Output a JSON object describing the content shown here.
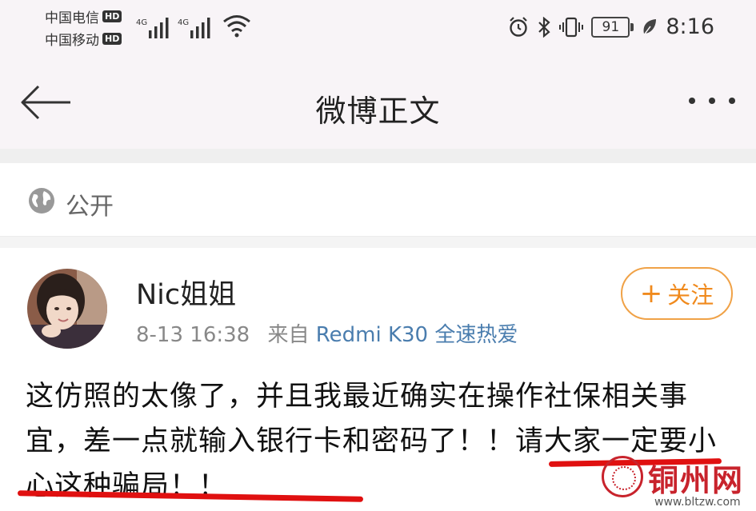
{
  "status_bar": {
    "carrier_1": "中国电信",
    "carrier_2": "中国移动",
    "hd_badge": "HD",
    "network_1": "4G",
    "network_2": "4G",
    "battery": "91",
    "time": "8:16",
    "icons": [
      "signal-icon",
      "wifi-icon",
      "alarm-icon",
      "bluetooth-icon",
      "vibrate-icon",
      "battery-icon",
      "leaf-icon"
    ]
  },
  "nav": {
    "title": "微博正文",
    "icons": [
      "back-arrow-icon",
      "more-icon"
    ]
  },
  "visibility": {
    "label": "公开",
    "icon": "globe-icon"
  },
  "post": {
    "author": "Nic姐姐",
    "time": "8-13 16:38",
    "source_prefix": "来自",
    "source": "Redmi K30 全速热爱",
    "follow_label": "关注",
    "follow_icon": "plus-icon",
    "text": "这仿照的太像了，并且我最近确实在操作社保相关事宜，差一点就输入银行卡和密码了！！请大家一定要小心这种骗局！！",
    "highlight_color": "#e01010"
  },
  "watermark": {
    "brand": "铜州网",
    "url": "www.bltzw.com",
    "color": "#c8232c"
  }
}
